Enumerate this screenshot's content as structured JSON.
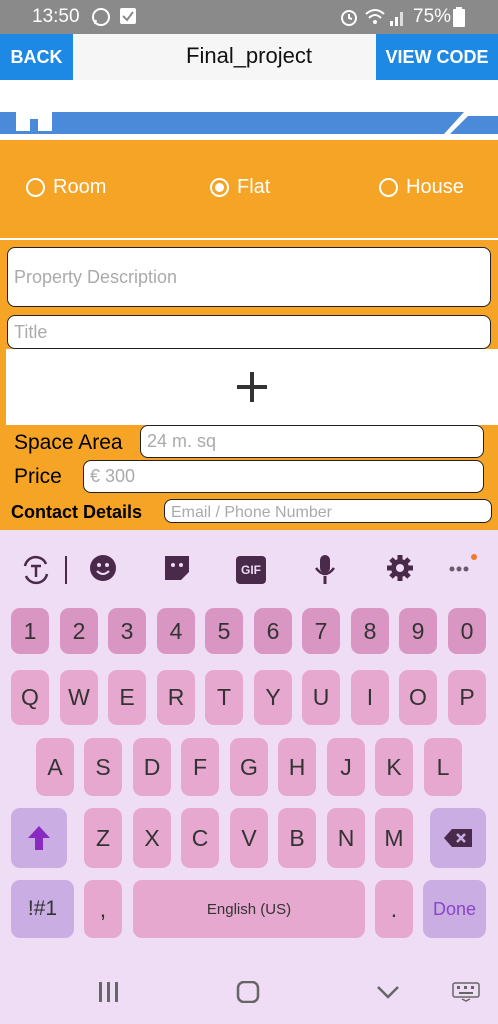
{
  "status_bar": {
    "time": "13:50",
    "battery": "75%"
  },
  "header": {
    "back_label": "BACK",
    "title": "Final_project",
    "view_code_label": "VIEW CODE"
  },
  "property_type": {
    "options": [
      {
        "label": "Room",
        "selected": false
      },
      {
        "label": "Flat",
        "selected": true
      },
      {
        "label": "House",
        "selected": false
      }
    ]
  },
  "form": {
    "description_placeholder": "Property Description",
    "title_placeholder": "Title",
    "add_image_symbol": "+",
    "space_area_label": "Space Area",
    "space_area_placeholder": "24 m. sq",
    "price_label": "Price",
    "price_placeholder": "€ 300",
    "contact_label": "Contact Details",
    "contact_placeholder": "Email / Phone Number"
  },
  "keyboard": {
    "row_numbers": [
      "1",
      "2",
      "3",
      "4",
      "5",
      "6",
      "7",
      "8",
      "9",
      "0"
    ],
    "row_top": [
      "Q",
      "W",
      "E",
      "R",
      "T",
      "Y",
      "U",
      "I",
      "O",
      "P"
    ],
    "row_middle": [
      "A",
      "S",
      "D",
      "F",
      "G",
      "H",
      "J",
      "K",
      "L"
    ],
    "row_bottom": [
      "Z",
      "X",
      "C",
      "V",
      "B",
      "N",
      "M"
    ],
    "symbols_label": "!#1",
    "comma_label": ",",
    "space_label": "English (US)",
    "period_label": ".",
    "done_label": "Done",
    "gif_label": "GIF"
  }
}
